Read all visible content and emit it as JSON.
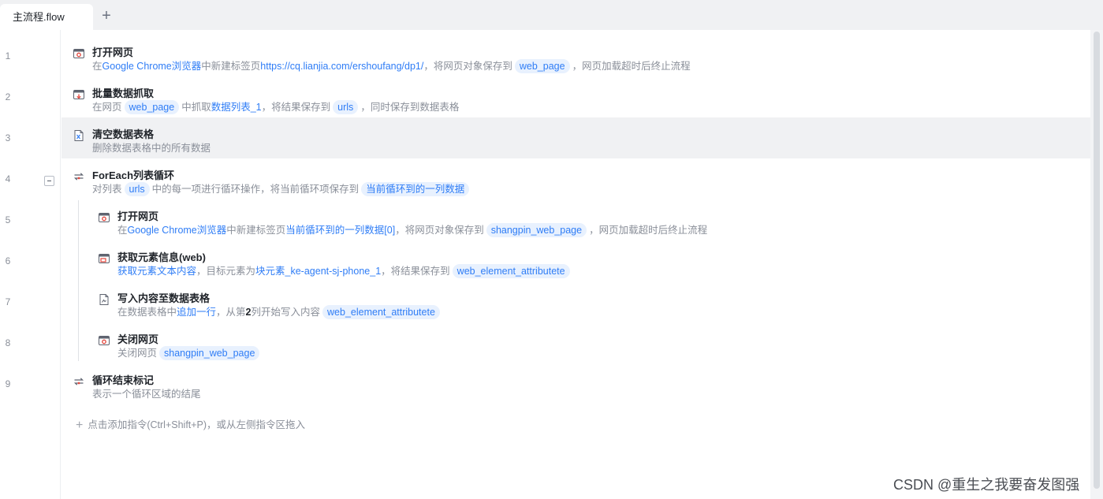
{
  "tabs": [
    {
      "label": "主流程.flow"
    }
  ],
  "add_tab_glyph": "+",
  "collapse_line": 4,
  "steps": [
    {
      "line": "1",
      "indent": 0,
      "icon": "browser-icon",
      "title": "打开网页",
      "desc": [
        {
          "t": "在",
          "c": "plain"
        },
        {
          "t": "Google Chrome浏览器",
          "c": "link"
        },
        {
          "t": "中新建标签页",
          "c": "plain"
        },
        {
          "t": "https://cq.lianjia.com/ershoufang/dp1/",
          "c": "link"
        },
        {
          "t": "，将网页对象保存到",
          "c": "plain"
        },
        {
          "t": "web_page",
          "c": "pill"
        },
        {
          "t": "，网页加载超时后终止流程",
          "c": "plain"
        }
      ]
    },
    {
      "line": "2",
      "indent": 0,
      "icon": "data-scrape-icon",
      "title": "批量数据抓取",
      "desc": [
        {
          "t": "在网页",
          "c": "plain"
        },
        {
          "t": "web_page",
          "c": "pill"
        },
        {
          "t": "中抓取",
          "c": "plain"
        },
        {
          "t": "数据列表_1",
          "c": "link"
        },
        {
          "t": "，将结果保存到",
          "c": "plain"
        },
        {
          "t": "urls",
          "c": "pill"
        },
        {
          "t": "，同时保存到数据表格",
          "c": "plain"
        }
      ]
    },
    {
      "line": "3",
      "indent": 0,
      "icon": "excel-clear-icon",
      "title": "清空数据表格",
      "selected": true,
      "desc": [
        {
          "t": "删除数据表格中的所有数据",
          "c": "plain"
        }
      ]
    },
    {
      "line": "4",
      "indent": 0,
      "icon": "loop-icon",
      "title": "ForEach列表循环",
      "desc": [
        {
          "t": "对列表",
          "c": "plain"
        },
        {
          "t": "urls",
          "c": "pill"
        },
        {
          "t": "中的每一项进行循环操作，将当前循环项保存到",
          "c": "plain"
        },
        {
          "t": "当前循环到的一列数据",
          "c": "pill"
        }
      ]
    },
    {
      "line": "5",
      "indent": 1,
      "icon": "browser-icon",
      "title": "打开网页",
      "desc": [
        {
          "t": "在",
          "c": "plain"
        },
        {
          "t": "Google Chrome浏览器",
          "c": "link"
        },
        {
          "t": "中新建标签页",
          "c": "plain"
        },
        {
          "t": "当前循环到的一列数据[0]",
          "c": "link"
        },
        {
          "t": "，将网页对象保存到",
          "c": "plain"
        },
        {
          "t": "shangpin_web_page",
          "c": "pill"
        },
        {
          "t": "，网页加载超时后终止流程",
          "c": "plain"
        }
      ]
    },
    {
      "line": "6",
      "indent": 1,
      "icon": "element-info-icon",
      "title": "获取元素信息(web)",
      "desc": [
        {
          "t": "获取元素文本内容",
          "c": "link"
        },
        {
          "t": "，目标元素为",
          "c": "plain"
        },
        {
          "t": "块元素_ke-agent-sj-phone_1",
          "c": "link"
        },
        {
          "t": "，将结果保存到",
          "c": "plain"
        },
        {
          "t": "web_element_attributete",
          "c": "pill"
        }
      ]
    },
    {
      "line": "7",
      "indent": 1,
      "icon": "write-table-icon",
      "title": "写入内容至数据表格",
      "desc": [
        {
          "t": "在数据表格中",
          "c": "plain"
        },
        {
          "t": "追加一行",
          "c": "link"
        },
        {
          "t": "，从第",
          "c": "plain"
        },
        {
          "t": "2",
          "c": "num"
        },
        {
          "t": "列开始写入内容",
          "c": "plain"
        },
        {
          "t": "web_element_attributete",
          "c": "pill"
        }
      ]
    },
    {
      "line": "8",
      "indent": 1,
      "icon": "browser-icon",
      "title": "关闭网页",
      "desc": [
        {
          "t": "关闭网页",
          "c": "plain"
        },
        {
          "t": "shangpin_web_page",
          "c": "pill"
        }
      ]
    },
    {
      "line": "9",
      "indent": 0,
      "icon": "loop-end-icon",
      "title": "循环结束标记",
      "desc": [
        {
          "t": "表示一个循环区域的结尾",
          "c": "plain"
        }
      ]
    }
  ],
  "add_hint": {
    "plus": "+",
    "label": "点击添加指令(Ctrl+Shift+P)，或从左侧指令区拖入"
  },
  "watermark": "CSDN @重生之我要奋发图强"
}
